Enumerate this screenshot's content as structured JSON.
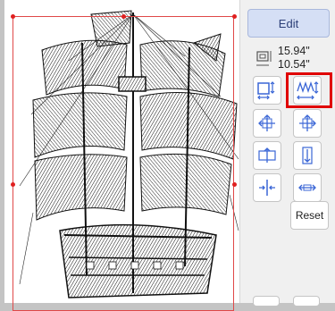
{
  "panel": {
    "edit_label": "Edit",
    "width_value": "15.94\"",
    "height_value": "10.54\"",
    "reset_label": "Reset"
  },
  "colors": {
    "selection": "#e02020",
    "highlight": "#e00000",
    "accent": "#3a66d6",
    "edit_bg": "#d5dff5"
  },
  "icons": [
    "size-icon",
    "resize-proportional-icon",
    "stretch-stitch-icon",
    "move-up-left-icon",
    "move-up-right-icon",
    "expand-horizontal-icon",
    "expand-vertical-icon",
    "center-horizontal-icon",
    "stretch-horizontal-icon"
  ]
}
